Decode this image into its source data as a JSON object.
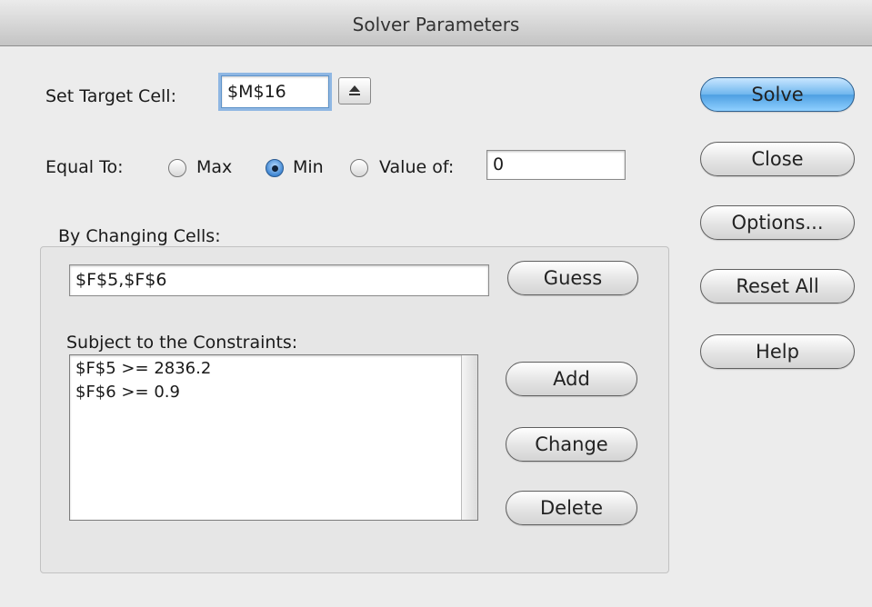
{
  "window": {
    "title": "Solver Parameters"
  },
  "target": {
    "label": "Set Target Cell:",
    "value": "$M$16"
  },
  "equal_to": {
    "label": "Equal To:",
    "options": [
      "Max",
      "Min",
      "Value of:"
    ],
    "selected": "Min",
    "value_of": "0"
  },
  "changing": {
    "label": "By Changing Cells:",
    "value": "$F$5,$F$6",
    "guess_label": "Guess"
  },
  "constraints": {
    "label": "Subject to the Constraints:",
    "items": [
      "$F$5 >= 2836.2",
      "$F$6 >= 0.9"
    ],
    "add_label": "Add",
    "change_label": "Change",
    "delete_label": "Delete"
  },
  "side_buttons": {
    "solve": "Solve",
    "close": "Close",
    "options": "Options...",
    "reset": "Reset All",
    "help": "Help"
  },
  "colors": {
    "default_button": "#4d9fe2",
    "focus_ring": "#8fb7e3",
    "background": "#ececec"
  }
}
